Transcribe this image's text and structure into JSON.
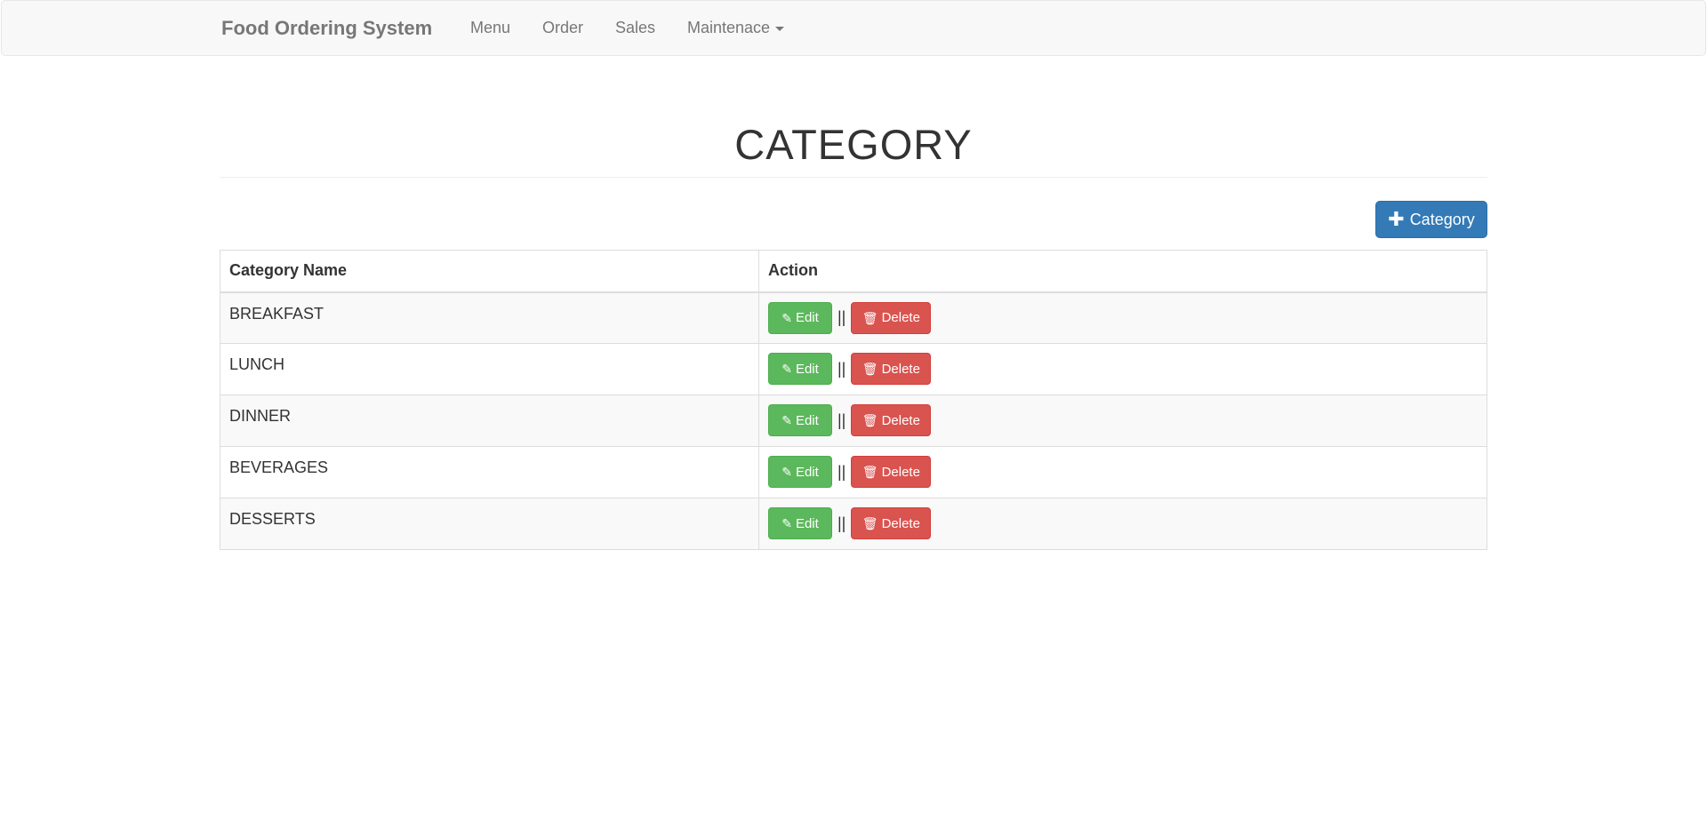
{
  "navbar": {
    "brand": "Food Ordering System",
    "links": {
      "menu": "Menu",
      "order": "Order",
      "sales": "Sales",
      "maintenance": "Maintenace"
    }
  },
  "page": {
    "title": "CATEGORY",
    "add_button_label": "Category",
    "add_button_icon": "plus-icon"
  },
  "table": {
    "headers": [
      "Category Name",
      "Action"
    ],
    "rows": [
      {
        "name": "BREAKFAST"
      },
      {
        "name": "LUNCH"
      },
      {
        "name": "DINNER"
      },
      {
        "name": "BEVERAGES"
      },
      {
        "name": "DESSERTS"
      }
    ],
    "edit_label": "Edit",
    "delete_label": "Delete",
    "separator": "||",
    "edit_icon": "pencil-icon",
    "delete_icon": "trash-icon"
  },
  "colors": {
    "primary": "#337ab7",
    "success": "#5cb85c",
    "danger": "#d9534f",
    "navbar_bg": "#f8f8f8"
  }
}
